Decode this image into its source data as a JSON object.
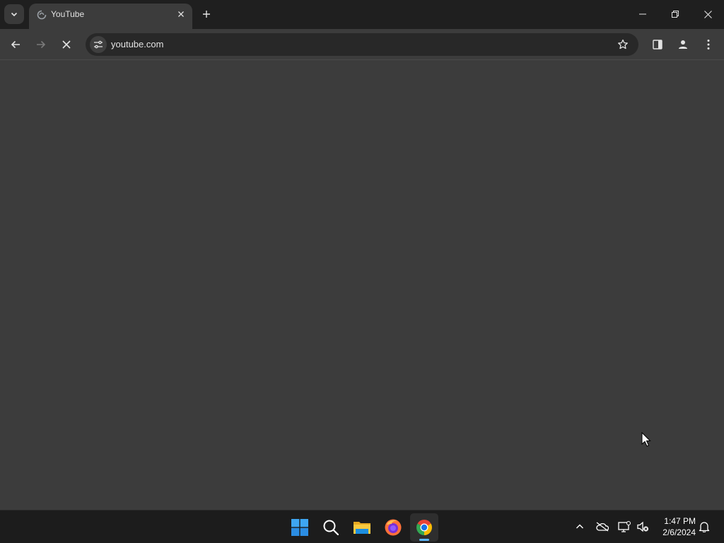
{
  "browser": {
    "tab": {
      "title": "YouTube"
    },
    "url": "youtube.com",
    "colors": {
      "frame": "#1f1f1f",
      "toolbar": "#3c3c3c",
      "omnibox": "#282828",
      "content": "#3c3c3c"
    },
    "icons": [
      "tab-search-icon",
      "loading-favicon-icon",
      "close-icon",
      "plus-icon",
      "minimize-icon",
      "restore-icon",
      "close-window-icon",
      "back-arrow-icon",
      "forward-arrow-icon",
      "stop-loading-icon",
      "site-settings-icon",
      "star-icon",
      "side-panel-icon",
      "profile-icon",
      "more-menu-icon"
    ]
  },
  "taskbar": {
    "apps": [
      "windows-start-icon",
      "search-icon",
      "file-explorer-icon",
      "firefox-icon",
      "chrome-icon"
    ],
    "active_app": "chrome",
    "tray": [
      "chevron-up-icon",
      "onedrive-offline-icon",
      "network-icon",
      "volume-muted-icon",
      "notification-bell-icon"
    ],
    "time": "1:47 PM",
    "date": "2/6/2024",
    "accent": "#5cb7ff"
  }
}
